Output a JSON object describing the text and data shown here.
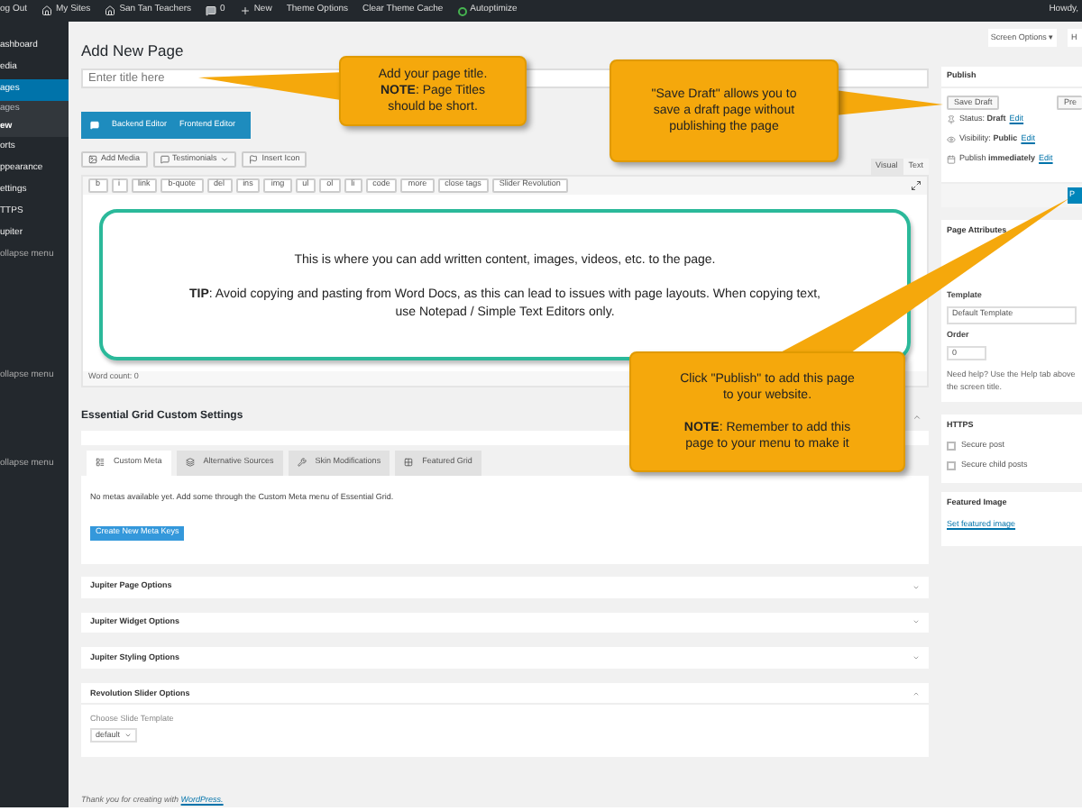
{
  "admin_bar": {
    "items": [
      {
        "kind": "text",
        "label": "og Out"
      },
      {
        "kind": "sites",
        "label": "My Sites"
      },
      {
        "kind": "home",
        "label": "San Tan Teachers"
      },
      {
        "kind": "comments",
        "label": "0"
      },
      {
        "kind": "new",
        "label": "New"
      },
      {
        "kind": "text",
        "label": "Theme Options"
      },
      {
        "kind": "text",
        "label": "Clear Theme Cache"
      },
      {
        "kind": "status",
        "label": "Autoptimize"
      }
    ],
    "greeting": "Howdy,"
  },
  "sidebar": {
    "items": [
      {
        "label": "ashboard",
        "kind": "menu",
        "selected": false
      },
      {
        "label": "edia",
        "kind": "menu",
        "selected": false
      },
      {
        "label": "ages",
        "kind": "menu",
        "selected": true
      },
      {
        "label": "ages",
        "kind": "submenu",
        "selected": false
      },
      {
        "label": "ew",
        "kind": "submenu",
        "selected": true
      },
      {
        "label": "orts",
        "kind": "menu",
        "selected": false
      },
      {
        "label": "ppearance",
        "kind": "menu",
        "selected": false
      },
      {
        "label": "ettings",
        "kind": "menu",
        "selected": false
      },
      {
        "label": "TTPS",
        "kind": "menu",
        "selected": false
      },
      {
        "label": "upiter",
        "kind": "menu",
        "selected": false
      },
      {
        "label": "ollapse menu",
        "kind": "collapse",
        "selected": false
      }
    ],
    "extra_items": [
      "ollapse menu",
      "ollapse menu"
    ]
  },
  "screen_options": {
    "label": "Screen Options ▾",
    "help": "H"
  },
  "page_title": "Add New Page",
  "title_field": {
    "placeholder": "Enter title here"
  },
  "editor_toggle": [
    "Backend Editor",
    "Frontend Editor"
  ],
  "media_buttons": [
    {
      "kind": "media",
      "label": "Add Media"
    },
    {
      "kind": "dropdown",
      "label": "Testimonials"
    },
    {
      "kind": "icon",
      "label": "Insert Icon"
    }
  ],
  "editor_tabs": [
    {
      "label": "Visual",
      "selected": false
    },
    {
      "label": "Text",
      "selected": true
    }
  ],
  "quicktags": [
    "b",
    "i",
    "link",
    "b-quote",
    "del",
    "ins",
    "img",
    "ul",
    "ol",
    "li",
    "code",
    "more",
    "close tags",
    "Slider Revolution"
  ],
  "editor_note": {
    "line": "This is where you can add written content, images, videos, etc. to the page.",
    "tip": "**TIP**: Avoid copying and pasting from Word Docs, as this can lead to issues with page layouts. When copying text, use Notepad / Simple Text Editors only."
  },
  "word_count": "Word count: 0",
  "essential_grid": {
    "title": "Essential Grid Custom Settings",
    "tabs": [
      {
        "label": "Custom Meta",
        "selected": true
      },
      {
        "label": "Alternative Sources",
        "selected": false
      },
      {
        "label": "Skin Modifications",
        "selected": false
      },
      {
        "label": "Featured Grid",
        "selected": false
      }
    ],
    "message": "No metas available yet. Add some through the Custom Meta menu of Essential Grid.",
    "button": "Create New Meta Keys"
  },
  "option_boxes": [
    "Jupiter Page Options",
    "Jupiter Widget Options",
    "Jupiter Styling Options"
  ],
  "revolution": {
    "title": "Revolution Slider Options",
    "label": "Choose Slide Template",
    "value": "default"
  },
  "footer": {
    "text": "Thank you for creating with",
    "link": "WordPress."
  },
  "publish": {
    "title": "Publish",
    "save_draft": "Save Draft",
    "preview": "Pre",
    "rows": [
      {
        "kind": "status",
        "text": "Status: **Draft**",
        "link": "Edit"
      },
      {
        "kind": "visibility",
        "text": "Visibility: **Public**",
        "link": "Edit"
      },
      {
        "kind": "schedule",
        "text": "Publish **immediately**",
        "link": "Edit"
      }
    ],
    "button": "P"
  },
  "page_attributes": {
    "title": "Page Attributes",
    "template_label": "Template",
    "template": "Default Template",
    "order_label": "Order",
    "order": "0",
    "help": "Need help? Use the Help tab above the screen title."
  },
  "https": {
    "title": "HTTPS",
    "options": [
      {
        "label": "Secure post",
        "checked": false
      },
      {
        "label": "Secure child posts",
        "checked": false
      }
    ]
  },
  "featured_image": {
    "title": "Featured Image",
    "link": "Set featured image"
  },
  "callouts": [
    {
      "text": "Add your page title.\n**NOTE**: Page Titles\nshould be short."
    },
    {
      "text": "\"Save Draft\" allows you to\nsave a draft page without\npublishing the page"
    },
    {
      "text": "Click \"Publish\" to add this page\nto your website.\n\n**NOTE**: Remember to add this\npage to your menu to make it"
    }
  ]
}
